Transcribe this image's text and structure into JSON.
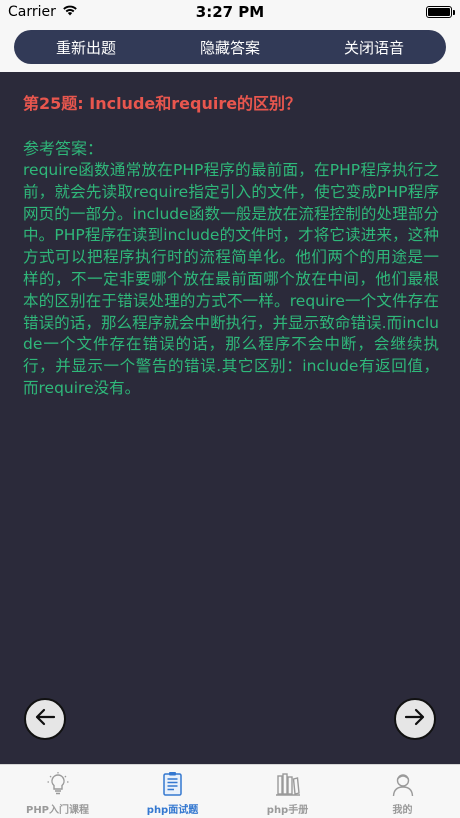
{
  "status": {
    "carrier": "Carrier",
    "time": "3:27 PM"
  },
  "toolbar": {
    "buttons": [
      "重新出题",
      "隐藏答案",
      "关闭语音"
    ]
  },
  "question": {
    "title": "第25题: Include和require的区别？",
    "answer_label": "参考答案：",
    "answer_text": "require函数通常放在PHP程序的最前面，在PHP程序执行之前，就会先读取require指定引入的文件，使它变成PHP程序网页的一部分。include函数一般是放在流程控制的处理部分中。PHP程序在读到include的文件时，才将它读进来，这种方式可以把程序执行时的流程简单化。他们两个的用途是一样的，不一定非要哪个放在最前面哪个放在中间，他们最根本的区别在于错误处理的方式不一样。require一个文件存在错误的话，那么程序就会中断执行，并显示致命错误.而include一个文件存在错误的话，那么程序不会中断，会继续执行，并显示一个警告的错误.其它区别：include有返回值，而require没有。"
  },
  "colors": {
    "title": "#e8564e",
    "answer": "#2fb87a",
    "background": "#2b2a3a",
    "toolbar": "#323a57",
    "tab_active": "#3478d0",
    "tab_inactive": "#9a9a9a"
  },
  "tabs": [
    {
      "label": "PHP入门课程",
      "icon": "lightbulb-icon",
      "active": false
    },
    {
      "label": "php面试题",
      "icon": "document-icon",
      "active": true
    },
    {
      "label": "php手册",
      "icon": "books-icon",
      "active": false
    },
    {
      "label": "我的",
      "icon": "user-icon",
      "active": false
    }
  ]
}
